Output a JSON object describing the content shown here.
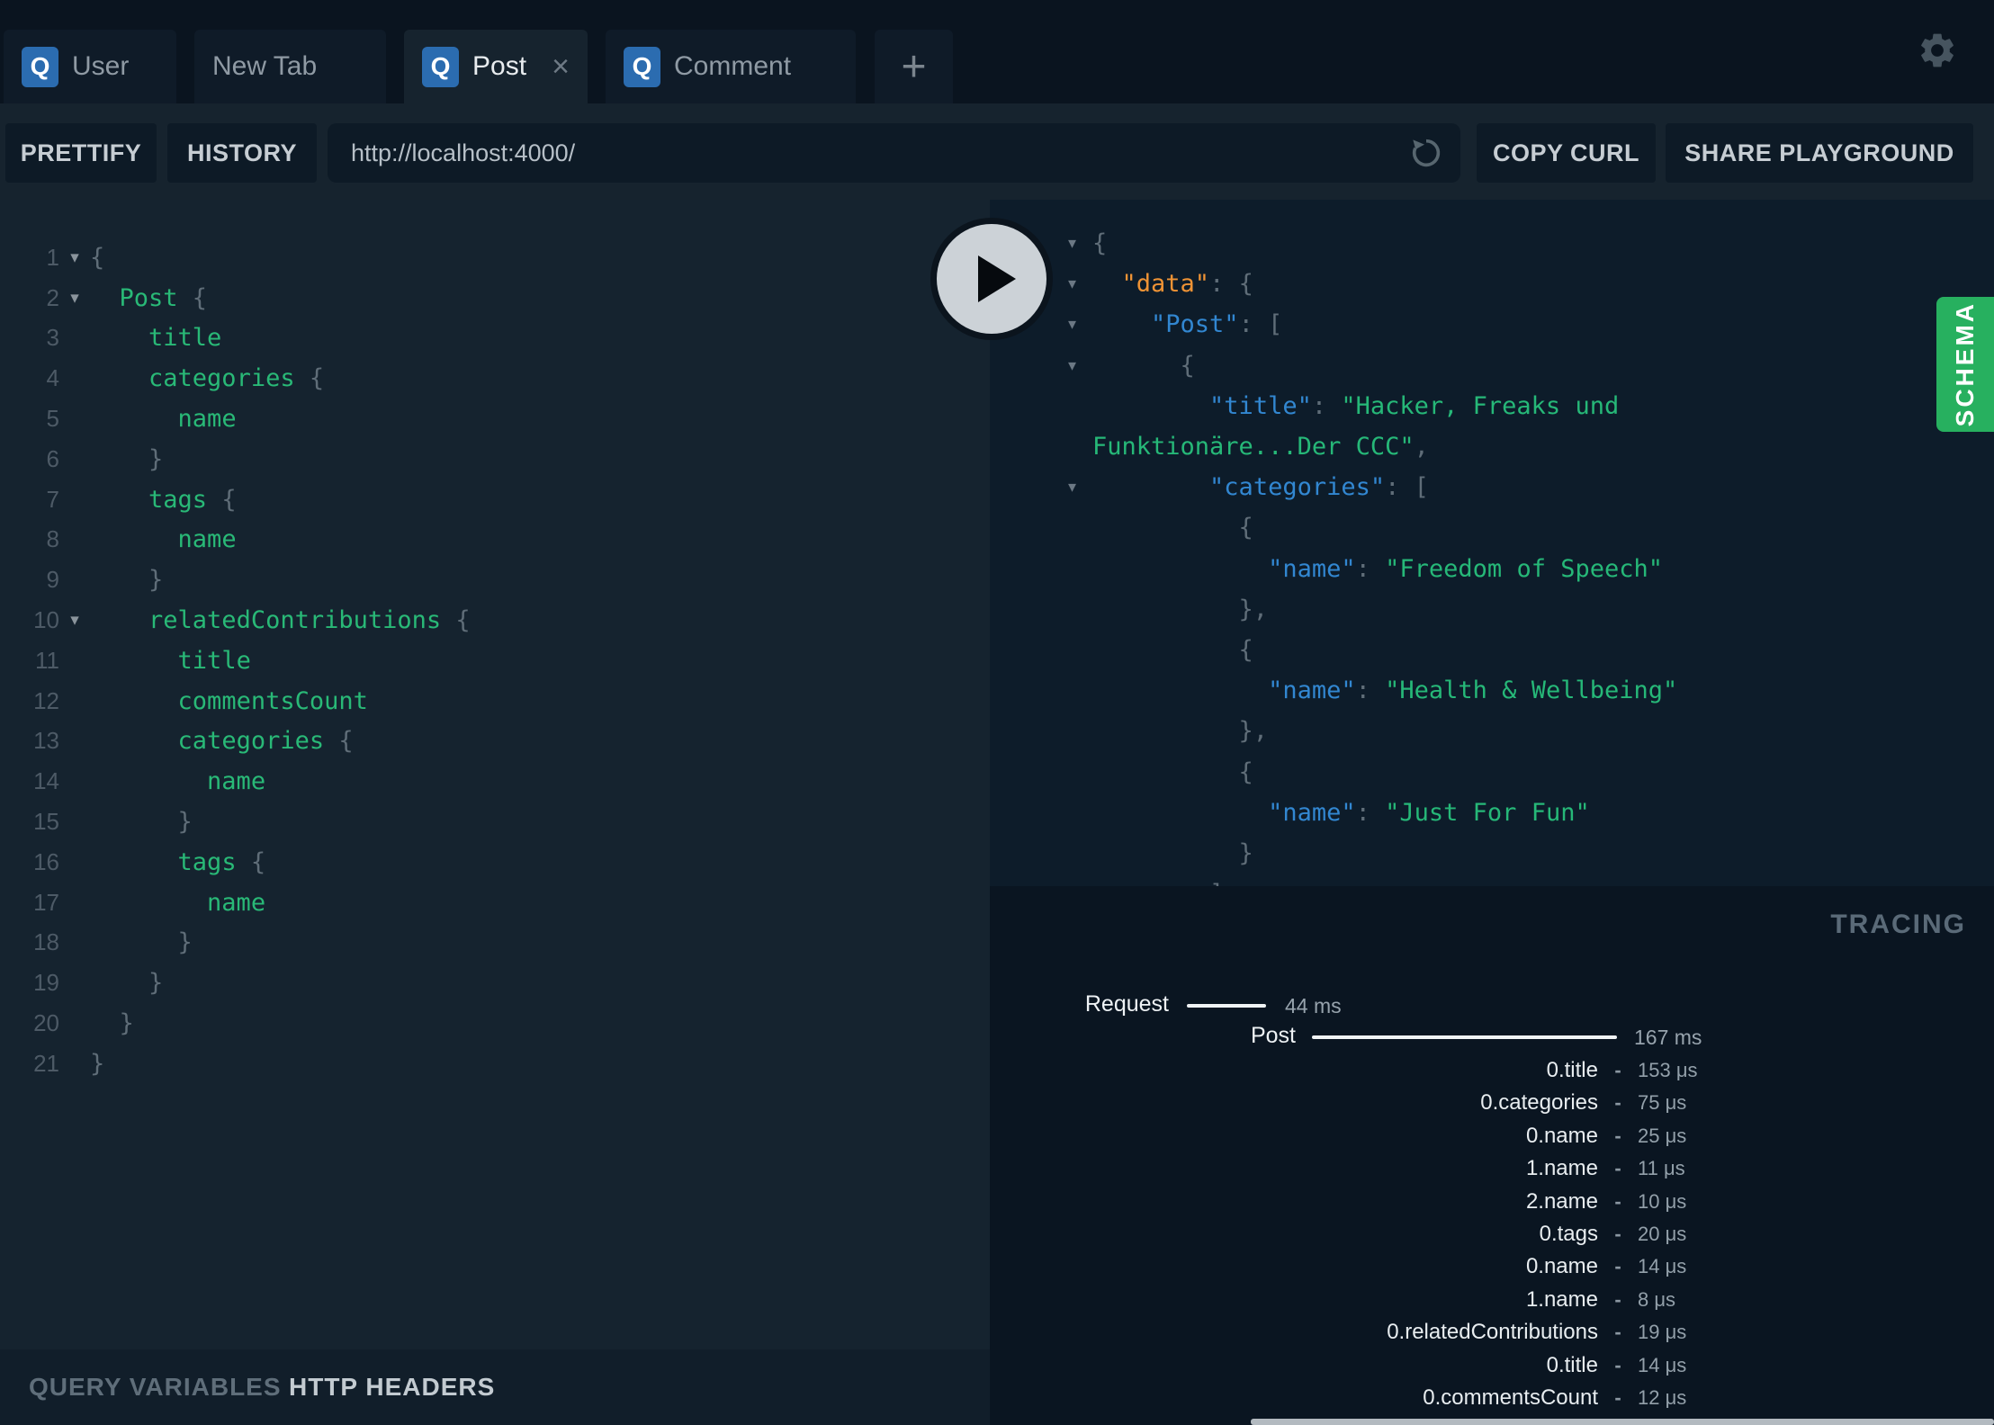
{
  "tab_bar": {
    "tabs": [
      {
        "label": "User",
        "q": true,
        "active": false,
        "close": false
      },
      {
        "label": "New Tab",
        "q": false,
        "active": false,
        "close": false
      },
      {
        "label": "Post",
        "q": true,
        "active": true,
        "close": true
      },
      {
        "label": "Comment",
        "q": true,
        "active": false,
        "close": false
      }
    ],
    "add_label": "+",
    "query_badge": "Q"
  },
  "toolbar": {
    "prettify": "PRETTIFY",
    "history": "HISTORY",
    "url": "http://localhost:4000/",
    "copy_curl": "COPY CURL",
    "share": "SHARE PLAYGROUND"
  },
  "editor": {
    "lines": [
      {
        "n": "1",
        "fold": true,
        "t": [
          [
            "p",
            "{"
          ]
        ]
      },
      {
        "n": "2",
        "fold": true,
        "t": [
          [
            "p",
            "  "
          ],
          [
            "f",
            "Post"
          ],
          [
            "p",
            " {"
          ]
        ]
      },
      {
        "n": "3",
        "t": [
          [
            "p",
            "    "
          ],
          [
            "f",
            "title"
          ]
        ]
      },
      {
        "n": "4",
        "t": [
          [
            "p",
            "    "
          ],
          [
            "f",
            "categories"
          ],
          [
            "p",
            " {"
          ]
        ]
      },
      {
        "n": "5",
        "t": [
          [
            "p",
            "      "
          ],
          [
            "f",
            "name"
          ]
        ]
      },
      {
        "n": "6",
        "t": [
          [
            "p",
            "    }"
          ]
        ]
      },
      {
        "n": "7",
        "t": [
          [
            "p",
            "    "
          ],
          [
            "f",
            "tags"
          ],
          [
            "p",
            " {"
          ]
        ]
      },
      {
        "n": "8",
        "t": [
          [
            "p",
            "      "
          ],
          [
            "f",
            "name"
          ]
        ]
      },
      {
        "n": "9",
        "t": [
          [
            "p",
            "    }"
          ]
        ]
      },
      {
        "n": "10",
        "fold": true,
        "t": [
          [
            "p",
            "    "
          ],
          [
            "f",
            "relatedContributions"
          ],
          [
            "p",
            " {"
          ]
        ]
      },
      {
        "n": "11",
        "t": [
          [
            "p",
            "      "
          ],
          [
            "f",
            "title"
          ]
        ]
      },
      {
        "n": "12",
        "t": [
          [
            "p",
            "      "
          ],
          [
            "f",
            "commentsCount"
          ]
        ]
      },
      {
        "n": "13",
        "t": [
          [
            "p",
            "      "
          ],
          [
            "f",
            "categories"
          ],
          [
            "p",
            " {"
          ]
        ]
      },
      {
        "n": "14",
        "t": [
          [
            "p",
            "        "
          ],
          [
            "f",
            "name"
          ]
        ]
      },
      {
        "n": "15",
        "t": [
          [
            "p",
            "      }"
          ]
        ]
      },
      {
        "n": "16",
        "t": [
          [
            "p",
            "      "
          ],
          [
            "f",
            "tags"
          ],
          [
            "p",
            " {"
          ]
        ]
      },
      {
        "n": "17",
        "t": [
          [
            "p",
            "        "
          ],
          [
            "f",
            "name"
          ]
        ]
      },
      {
        "n": "18",
        "t": [
          [
            "p",
            "      }"
          ]
        ]
      },
      {
        "n": "19",
        "t": [
          [
            "p",
            "    }"
          ]
        ]
      },
      {
        "n": "20",
        "t": [
          [
            "p",
            "  }"
          ]
        ]
      },
      {
        "n": "21",
        "t": [
          [
            "p",
            "}"
          ]
        ]
      }
    ]
  },
  "response": {
    "lines": [
      {
        "arrow": true,
        "t": [
          [
            "p",
            "{"
          ]
        ]
      },
      {
        "arrow": true,
        "t": [
          [
            "p",
            "  "
          ],
          [
            "ko",
            "\"data\""
          ],
          [
            "p",
            ": {"
          ]
        ]
      },
      {
        "arrow": true,
        "t": [
          [
            "p",
            "    "
          ],
          [
            "kb",
            "\"Post\""
          ],
          [
            "p",
            ": ["
          ]
        ]
      },
      {
        "arrow": true,
        "t": [
          [
            "p",
            "      {"
          ]
        ]
      },
      {
        "arrow": false,
        "t": [
          [
            "p",
            "        "
          ],
          [
            "kb",
            "\"title\""
          ],
          [
            "p",
            ": "
          ],
          [
            "s",
            "\"Hacker, Freaks und"
          ]
        ]
      },
      {
        "arrow": false,
        "t": [
          [
            "s",
            "Funktionäre...Der CCC\""
          ],
          [
            "p",
            ","
          ]
        ]
      },
      {
        "arrow": true,
        "t": [
          [
            "p",
            "        "
          ],
          [
            "kb",
            "\"categories\""
          ],
          [
            "p",
            ": ["
          ]
        ]
      },
      {
        "arrow": false,
        "t": [
          [
            "p",
            "          {"
          ]
        ]
      },
      {
        "arrow": false,
        "t": [
          [
            "p",
            "            "
          ],
          [
            "kb",
            "\"name\""
          ],
          [
            "p",
            ": "
          ],
          [
            "s",
            "\"Freedom of Speech\""
          ]
        ]
      },
      {
        "arrow": false,
        "t": [
          [
            "p",
            "          },"
          ]
        ]
      },
      {
        "arrow": false,
        "t": [
          [
            "p",
            "          {"
          ]
        ]
      },
      {
        "arrow": false,
        "t": [
          [
            "p",
            "            "
          ],
          [
            "kb",
            "\"name\""
          ],
          [
            "p",
            ": "
          ],
          [
            "s",
            "\"Health & Wellbeing\""
          ]
        ]
      },
      {
        "arrow": false,
        "t": [
          [
            "p",
            "          },"
          ]
        ]
      },
      {
        "arrow": false,
        "t": [
          [
            "p",
            "          {"
          ]
        ]
      },
      {
        "arrow": false,
        "t": [
          [
            "p",
            "            "
          ],
          [
            "kb",
            "\"name\""
          ],
          [
            "p",
            ": "
          ],
          [
            "s",
            "\"Just For Fun\""
          ]
        ]
      },
      {
        "arrow": false,
        "t": [
          [
            "p",
            "          }"
          ]
        ]
      },
      {
        "arrow": false,
        "t": [
          [
            "p",
            "        ]"
          ]
        ]
      }
    ]
  },
  "schema_label": "SCHEMA",
  "tracing": {
    "title": "TRACING",
    "request": {
      "label": "Request",
      "duration": "44 ms"
    },
    "root": {
      "label": "Post",
      "duration": "167 ms"
    },
    "resolvers": [
      [
        "0.title",
        "153 μs"
      ],
      [
        "0.categories",
        "75 μs"
      ],
      [
        "0.name",
        "25 μs"
      ],
      [
        "1.name",
        "11 μs"
      ],
      [
        "2.name",
        "10 μs"
      ],
      [
        "0.tags",
        "20 μs"
      ],
      [
        "0.name",
        "14 μs"
      ],
      [
        "1.name",
        "8 μs"
      ],
      [
        "0.relatedContributions",
        "19 μs"
      ],
      [
        "0.title",
        "14 μs"
      ],
      [
        "0.commentsCount",
        "12 μs"
      ]
    ]
  },
  "footer": {
    "query_variables": "QUERY VARIABLES",
    "http_headers": "HTTP HEADERS"
  },
  "colors": {
    "accent_green": "#27b05f",
    "badge_blue": "#2b6cb0",
    "key_orange": "#ef9335",
    "key_blue": "#3287d1",
    "string_green": "#26b878",
    "field_green": "#29b977"
  }
}
